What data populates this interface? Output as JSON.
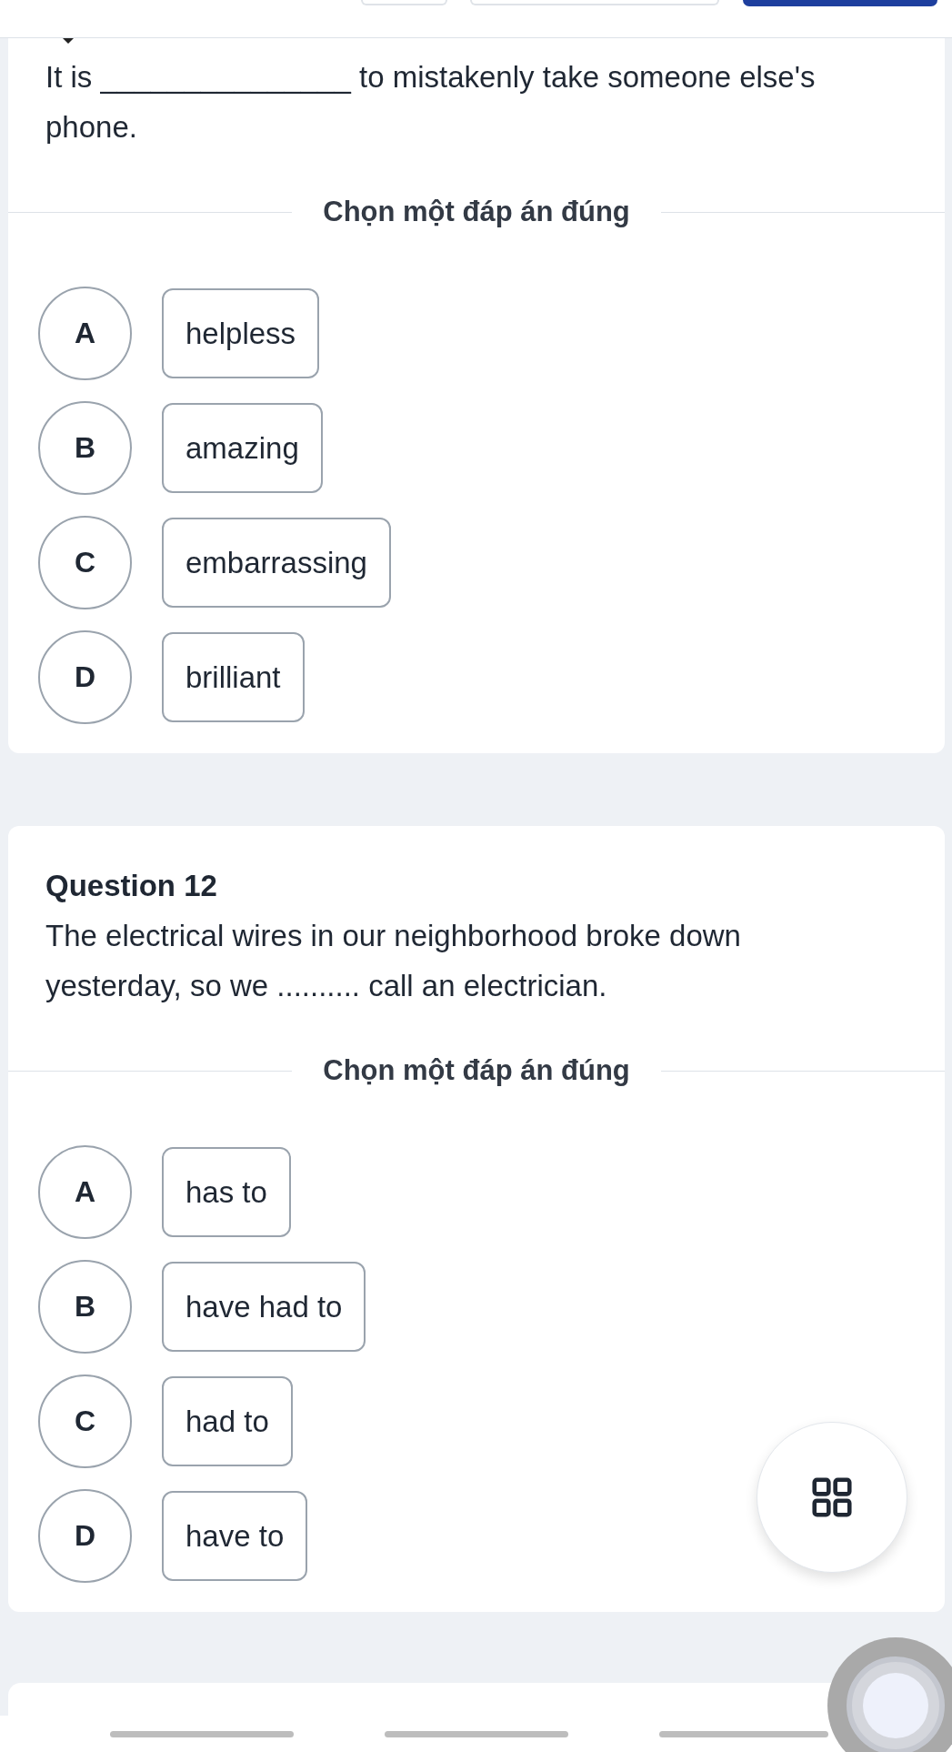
{
  "questions": [
    {
      "text": "It is _______________ to mistakenly take someone else's phone.",
      "prompt": "Chọn một đáp án đúng",
      "options": [
        {
          "letter": "A",
          "text": "helpless",
          "selected": false
        },
        {
          "letter": "B",
          "text": "amazing",
          "selected": false
        },
        {
          "letter": "C",
          "text": "embarrassing",
          "selected": false
        },
        {
          "letter": "D",
          "text": "brilliant",
          "selected": false
        }
      ]
    },
    {
      "title": "Question 12",
      "text": "The electrical wires in our neighborhood broke down yesterday, so we .......... call an electrician.",
      "prompt": "Chọn một đáp án đúng",
      "options": [
        {
          "letter": "A",
          "text": "has to",
          "selected": false
        },
        {
          "letter": "B",
          "text": "have had to",
          "selected": false
        },
        {
          "letter": "C",
          "text": "had to",
          "selected": false
        },
        {
          "letter": "D",
          "text": "have to",
          "selected": false
        }
      ]
    }
  ]
}
